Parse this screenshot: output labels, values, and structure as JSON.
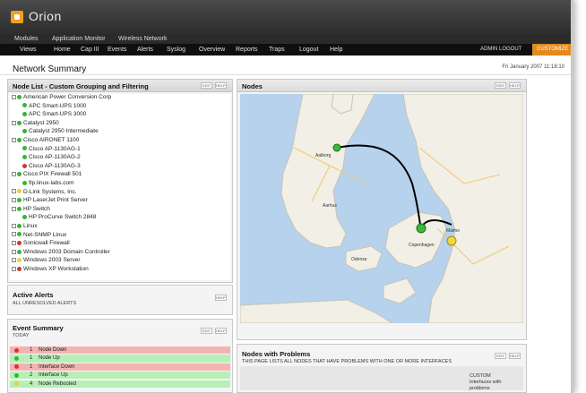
{
  "app": {
    "title": "Orion"
  },
  "modules": [
    "Modules",
    "Application Monitor",
    "Wireless Network"
  ],
  "nav": {
    "items": [
      "Views",
      "Home",
      "Cap III",
      "Events",
      "Alerts",
      "Syslog",
      "Overview",
      "Reports",
      "Traps",
      "Logout",
      "Help"
    ],
    "user": "ADMIN LOGOUT",
    "user_button": "CUSTOMIZE"
  },
  "page": {
    "title": "Network Summary",
    "date": "Fri January 2007 11:18:10"
  },
  "node_list": {
    "title": "Node List - Custom Grouping and Filtering",
    "btn_edit": "EDIT",
    "btn_help": "HELP",
    "rows": [
      {
        "label": "American Power Conversion Corp",
        "status": "g",
        "depth": 0
      },
      {
        "label": "APC Smart-UPS 1000",
        "status": "g",
        "depth": 1
      },
      {
        "label": "APC Smart-UPS 3000",
        "status": "g",
        "depth": 1
      },
      {
        "label": "Catalyst 2950",
        "status": "g",
        "depth": 0
      },
      {
        "label": "Catalyst 2950 Intermediate",
        "status": "g",
        "depth": 1
      },
      {
        "label": "Cisco AIRONET 1100",
        "status": "g",
        "depth": 0
      },
      {
        "label": "Cisco AP-1130AG-1",
        "status": "g",
        "depth": 1
      },
      {
        "label": "Cisco AP-1130AG-2",
        "status": "g",
        "depth": 1
      },
      {
        "label": "Cisco AP-1130AG-3",
        "status": "r",
        "depth": 1
      },
      {
        "label": "Cisco PIX Firewall 501",
        "status": "g",
        "depth": 0
      },
      {
        "label": "ftp.linux-labs.com",
        "status": "g",
        "depth": 1
      },
      {
        "label": "D-Link Systems, Inc.",
        "status": "y",
        "depth": 0
      },
      {
        "label": "HP LaserJet Print Server",
        "status": "g",
        "depth": 0
      },
      {
        "label": "HP Switch",
        "status": "g",
        "depth": 0
      },
      {
        "label": "HP ProCurve Switch 2848",
        "status": "g",
        "depth": 1
      },
      {
        "label": "Linux",
        "status": "g",
        "depth": 0
      },
      {
        "label": "Net-SNMP Linux",
        "status": "g",
        "depth": 0
      },
      {
        "label": "Sonicwall Firewall",
        "status": "r",
        "depth": 0
      },
      {
        "label": "Windows 2003 Domain Controller",
        "status": "g",
        "depth": 0
      },
      {
        "label": "Windows 2003 Server",
        "status": "y",
        "depth": 0
      },
      {
        "label": "Windows XP Workstation",
        "status": "r",
        "depth": 0
      }
    ]
  },
  "active_alerts": {
    "title": "Active Alerts",
    "subtitle": "ALL UNRESOLVED ALERTS",
    "btn_help": "HELP"
  },
  "event_summary": {
    "title": "Event Summary",
    "subtitle": "TODAY",
    "btn_edit": "EDIT",
    "btn_help": "HELP",
    "rows": [
      {
        "count": "1",
        "text": "Node Down",
        "color": "#f4b3b3",
        "icon": "r"
      },
      {
        "count": "1",
        "text": "Node Up",
        "color": "#b7efb7",
        "icon": "g"
      },
      {
        "count": "1",
        "text": "Interface Down",
        "color": "#f4b3b3",
        "icon": "r"
      },
      {
        "count": "2",
        "text": "Interface Up",
        "color": "#b7efb7",
        "icon": "g"
      },
      {
        "count": "4",
        "text": "Node Rebooted",
        "color": "#b7efb7",
        "icon": "y"
      }
    ]
  },
  "nodes_map": {
    "title": "Nodes",
    "btn_edit": "EDIT",
    "btn_help": "HELP",
    "cities": [
      "Aalborg",
      "Copenhagen",
      "Malmo",
      "Odense",
      "Aarhus"
    ]
  },
  "problems": {
    "title": "Nodes with Problems",
    "subtitle": "THIS PAGE LISTS ALL NODES THAT HAVE PROBLEMS WITH ONE OR MORE INTERFACES",
    "btn_edit": "EDIT",
    "btn_help": "HELP",
    "footer": [
      "CUSTOM",
      "Interfaces with",
      "problems"
    ]
  },
  "colors": {
    "accent": "#e38a1e",
    "navbg": "#0f0f0f",
    "titlebg": "#3a3a3a"
  }
}
